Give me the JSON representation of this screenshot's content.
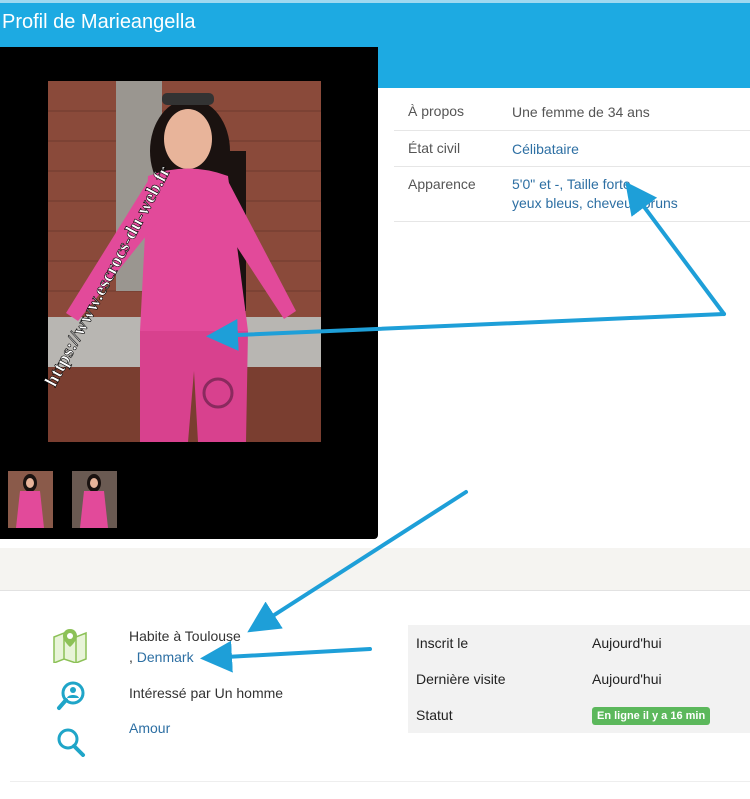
{
  "header": {
    "title": "Profil de Marieangella"
  },
  "watermark": "https://www.escrocs-du-web.fr",
  "profile": {
    "about_label": "À propos",
    "about_value": "Une femme de 34 ans",
    "civil_label": "État civil",
    "civil_value": "Célibataire",
    "appearance_label": "Apparence",
    "appearance_line1": "5'0\" et -, Taille forte",
    "appearance_line2": "yeux bleus, cheveux bruns"
  },
  "location": {
    "lives_in": "Habite à Toulouse",
    "comma": ",",
    "country": "Denmark",
    "interested": "Intéressé par Un homme",
    "looking_for": "Amour"
  },
  "stats": {
    "joined_label": "Inscrit le",
    "joined_value": "Aujourd'hui",
    "last_visit_label": "Dernière visite",
    "last_visit_value": "Aujourd'hui",
    "status_label": "Statut",
    "status_badge": "En ligne il y a 16 min"
  },
  "colors": {
    "header": "#1daae2",
    "link": "#2d6fa3",
    "badge": "#5cb85c",
    "arrow": "#1e9fd8"
  }
}
